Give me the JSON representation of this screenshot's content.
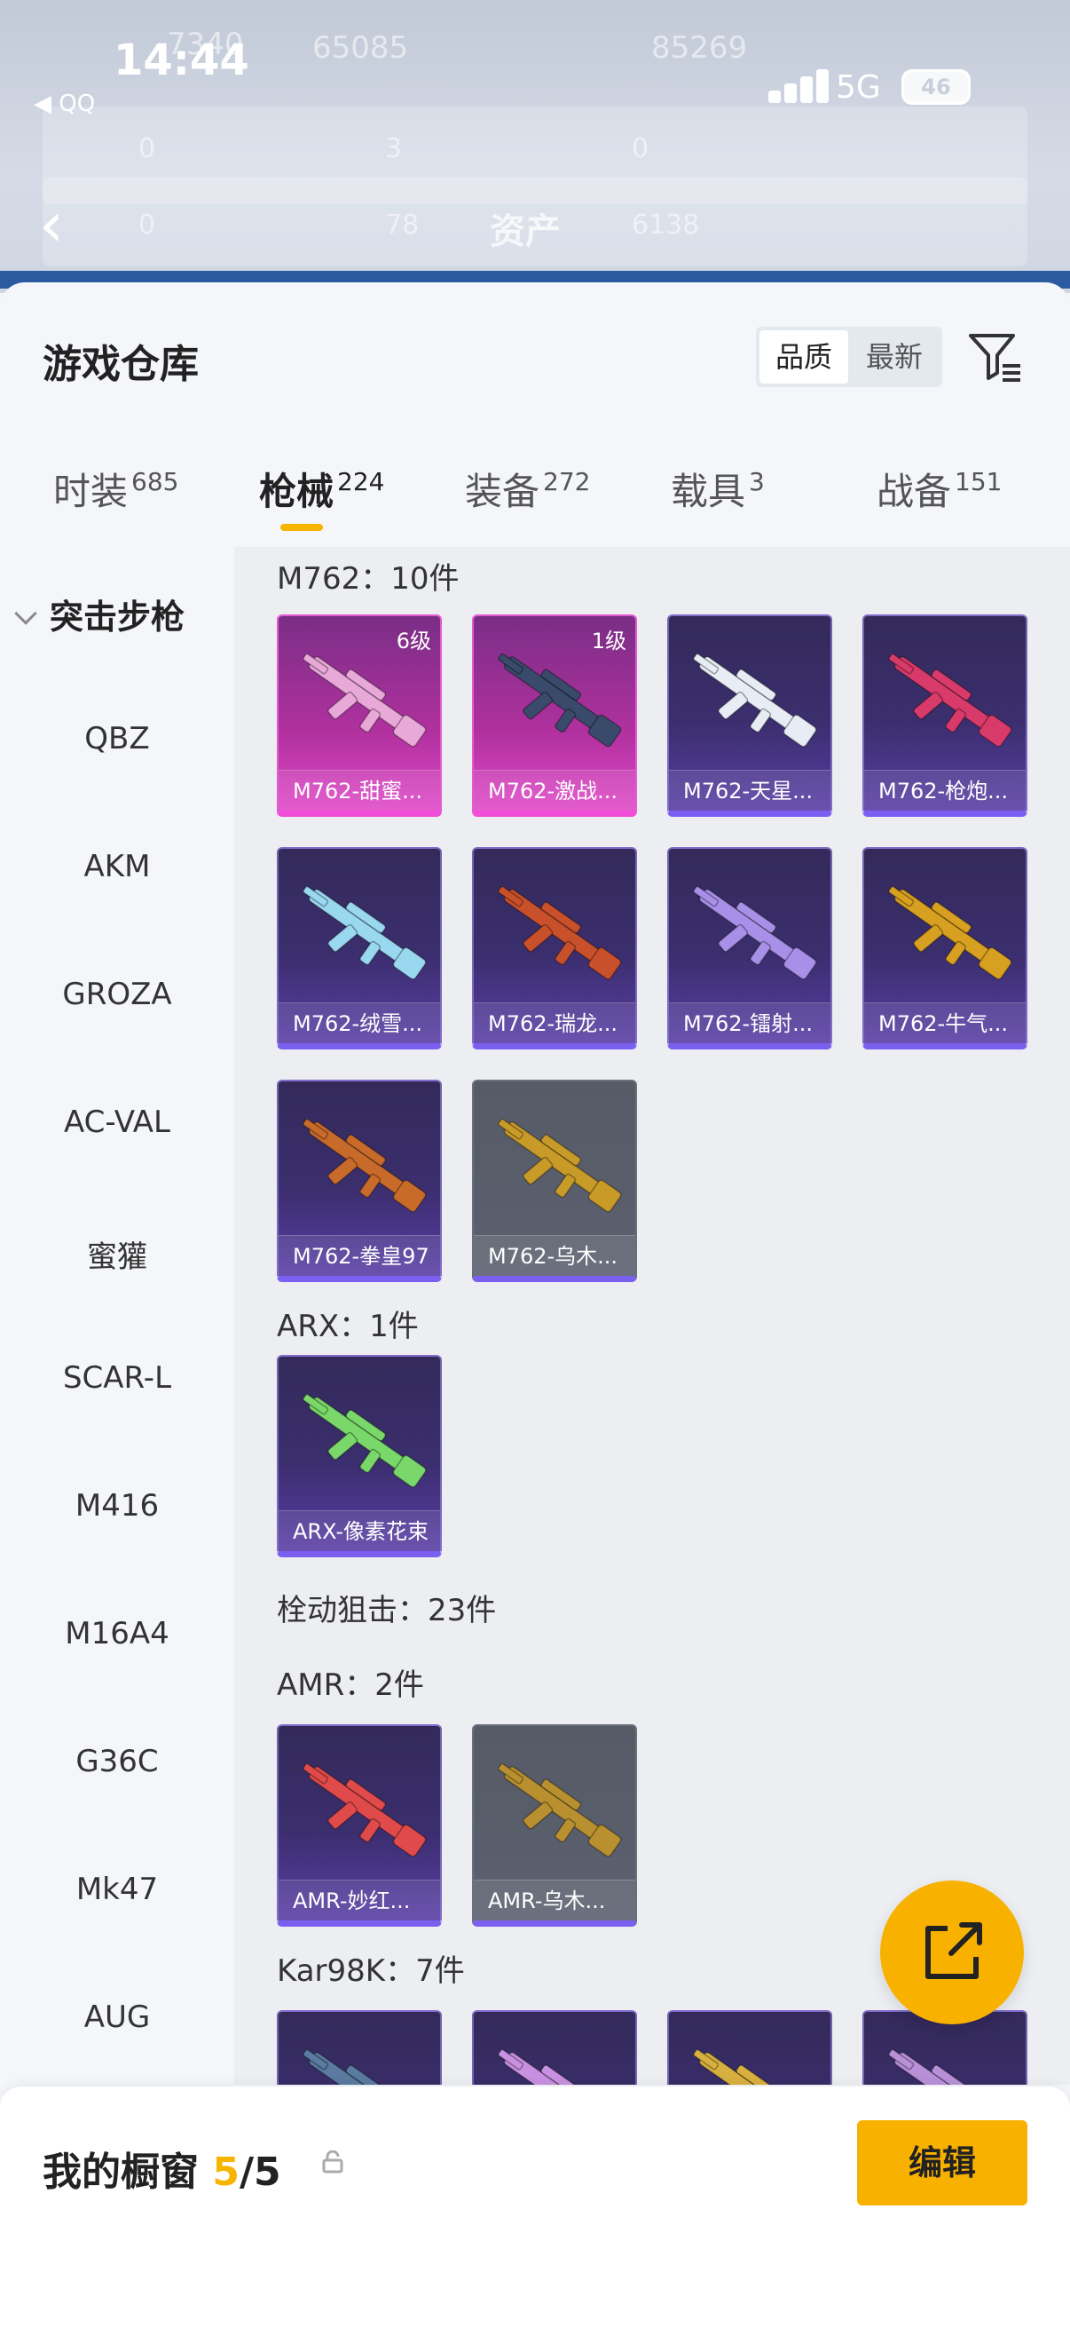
{
  "status_bar": {
    "time": "14:44",
    "back_app": "◀ QQ",
    "network": "5G",
    "battery": "46"
  },
  "background_header": {
    "title": "资产",
    "faded_values": [
      "7340",
      "65085",
      "85269",
      "0",
      "3",
      "0",
      "0",
      "78",
      "6138"
    ]
  },
  "panel": {
    "title": "游戏仓库",
    "sort": {
      "quality": "品质",
      "newest": "最新"
    }
  },
  "tabs": [
    {
      "label": "时装",
      "count": "685"
    },
    {
      "label": "枪械",
      "count": "224"
    },
    {
      "label": "装备",
      "count": "272"
    },
    {
      "label": "载具",
      "count": "3"
    },
    {
      "label": "战备",
      "count": "151"
    }
  ],
  "sidebar": {
    "heading": "突击步枪",
    "items": [
      "QBZ",
      "AKM",
      "GROZA",
      "AC-VAL",
      "蜜獾",
      "SCAR-L",
      "M416",
      "M16A4",
      "G36C",
      "Mk47",
      "AUG"
    ]
  },
  "groups": [
    {
      "title": "M762：10件",
      "items": [
        {
          "name": "M762-甜蜜...",
          "level": "6级",
          "rarity": "pink",
          "gun": "#e8a8d8"
        },
        {
          "name": "M762-激战...",
          "level": "1级",
          "rarity": "pink",
          "gun": "#3a4a6a"
        },
        {
          "name": "M762-天星...",
          "level": "",
          "rarity": "purple",
          "gun": "#e8ecf4"
        },
        {
          "name": "M762-枪炮...",
          "level": "",
          "rarity": "purple",
          "gun": "#d83a6a"
        },
        {
          "name": "M762-绒雪...",
          "level": "",
          "rarity": "purple",
          "gun": "#9ad8f0"
        },
        {
          "name": "M762-瑞龙...",
          "level": "",
          "rarity": "purple",
          "gun": "#c8502a"
        },
        {
          "name": "M762-镭射...",
          "level": "",
          "rarity": "purple",
          "gun": "#a890e8"
        },
        {
          "name": "M762-牛气...",
          "level": "",
          "rarity": "purple",
          "gun": "#d8a020"
        },
        {
          "name": "M762-拳皇97",
          "level": "",
          "rarity": "purple",
          "gun": "#c86a2a"
        },
        {
          "name": "M762-乌木...",
          "level": "",
          "rarity": "grey",
          "gun": "#c89a28"
        }
      ]
    },
    {
      "title": "ARX：1件",
      "items": [
        {
          "name": "ARX-像素花束",
          "level": "",
          "rarity": "purple",
          "gun": "#7ad86a"
        }
      ]
    },
    {
      "title": "栓动狙击：23件",
      "items": []
    },
    {
      "title": "AMR：2件",
      "items": [
        {
          "name": "AMR-妙红...",
          "level": "",
          "rarity": "purple",
          "gun": "#e04a4a"
        },
        {
          "name": "AMR-乌木...",
          "level": "",
          "rarity": "grey",
          "gun": "#b89030"
        }
      ]
    },
    {
      "title": "Kar98K：7件",
      "items": [
        {
          "name": "",
          "level": "",
          "rarity": "purple",
          "gun": "#5a7aa0"
        },
        {
          "name": "",
          "level": "",
          "rarity": "purple",
          "gun": "#c890e0"
        },
        {
          "name": "",
          "level": "",
          "rarity": "purple",
          "gun": "#d8b040"
        },
        {
          "name": "",
          "level": "",
          "rarity": "purple",
          "gun": "#b890d8"
        }
      ]
    }
  ],
  "bottom_bar": {
    "label": "我的橱窗",
    "current": "5",
    "total": "/5",
    "edit_label": "编辑"
  },
  "icons": {
    "filter": "filter-icon",
    "share": "share-external-icon",
    "lock": "lock-icon",
    "back": "back-chevron-icon"
  },
  "colors": {
    "accent": "#f9b100",
    "pink_rarity": "#e049c8",
    "purple_rarity": "#7a5ff0"
  }
}
